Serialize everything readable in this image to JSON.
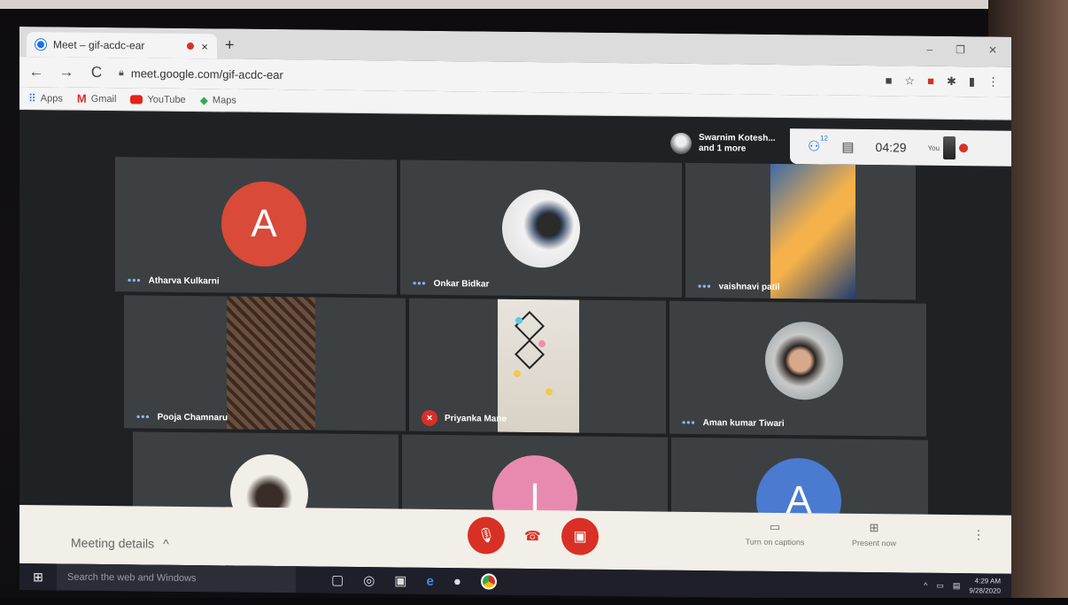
{
  "browser": {
    "tab_title": "Meet – gif-acdc-ear",
    "tab_close": "×",
    "new_tab": "+",
    "url": "meet.google.com/gif-acdc-ear",
    "window_controls": [
      "–",
      "❐",
      "✕"
    ]
  },
  "bookmarks": [
    {
      "label": "Apps",
      "icon": "apps-grid-icon"
    },
    {
      "label": "Gmail",
      "icon": "gmail-icon"
    },
    {
      "label": "YouTube",
      "icon": "youtube-icon"
    },
    {
      "label": "Maps",
      "icon": "maps-icon"
    }
  ],
  "meet": {
    "presence_line1": "Swarnim Kotesh...",
    "presence_line2": "and 1 more",
    "people_count": "12",
    "clock": "04:29",
    "you_label": "You",
    "tiles": [
      {
        "name": "Atharva Kulkarni",
        "letter": "A",
        "color": "#d94a38"
      },
      {
        "name": "Onkar Bidkar"
      },
      {
        "name": "vaishnavi patil"
      },
      {
        "name": "Pooja Chamnaru"
      },
      {
        "name": "Priyanka Mane"
      },
      {
        "name": "Aman kumar Tiwari"
      },
      {
        "name": ""
      },
      {
        "name": "",
        "letter": "I",
        "color": "#e88ab0"
      },
      {
        "name": "",
        "letter": "A",
        "color": "#4a7bd0"
      }
    ]
  },
  "controls": {
    "meeting_details": "Meeting details",
    "captions_label": "Turn on captions",
    "present_label": "Present now"
  },
  "taskbar": {
    "search_placeholder": "Search the web and Windows",
    "time": "4:29 AM",
    "date": "9/28/2020"
  }
}
